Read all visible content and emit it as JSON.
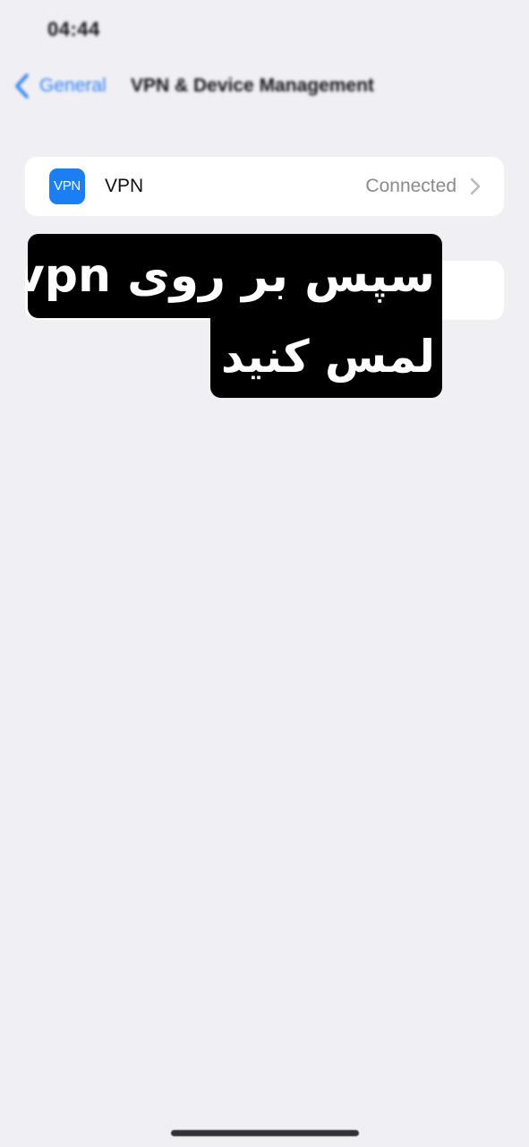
{
  "status_bar": {
    "time": "04:44"
  },
  "nav": {
    "back_label": "General",
    "title": "VPN & Device Management"
  },
  "vpn_row": {
    "icon_text": "VPN",
    "label": "VPN",
    "status": "Connected"
  },
  "overlay": {
    "line1": "سپس بر روی vpn",
    "line2": "لمس کنید"
  },
  "icons": {
    "back": "chevron-left-icon",
    "row_disclosure": "chevron-right-icon",
    "vpn": "vpn-icon"
  },
  "colors": {
    "background": "#f0f0f4",
    "accent": "#2f7ef6",
    "vpn_icon": "#1b7ef2",
    "secondary_text": "#8a8a8e",
    "overlay_bg": "#000000"
  }
}
